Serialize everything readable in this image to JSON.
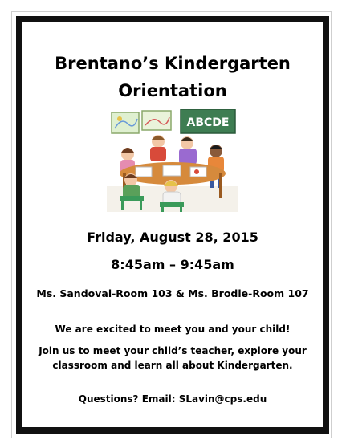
{
  "flyer": {
    "title_line1": "Brentano’s Kindergarten",
    "title_line2": "Orientation",
    "illustration_board_text": "ABCDE",
    "date": "Friday, August 28, 2015",
    "time": "8:45am – 9:45am",
    "rooms": "Ms. Sandoval-Room 103 & Ms. Brodie-Room 107",
    "excited": "We are excited to meet you and your child!",
    "join": "Join us to meet your child’s teacher, explore your classroom and learn all about Kindergarten.",
    "questions": "Questions? Email: SLavin@cps.edu"
  },
  "colors": {
    "border": "#111111",
    "chalkboard": "#3e7d52",
    "table": "#d68a3c"
  }
}
